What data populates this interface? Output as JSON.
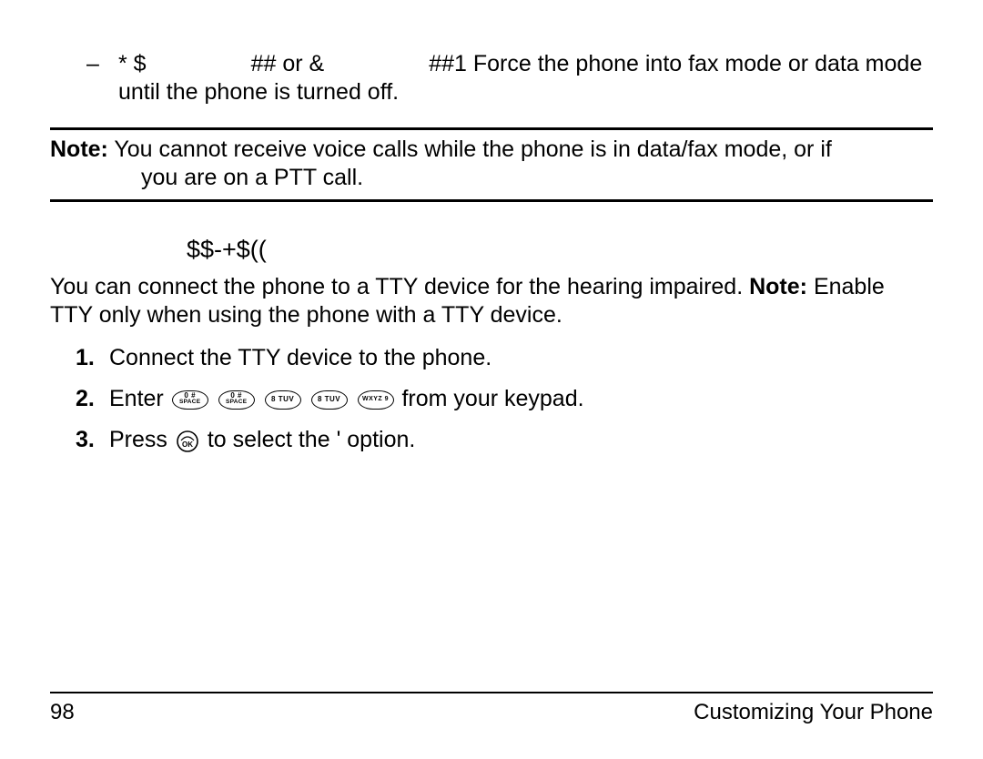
{
  "bullet": {
    "dash": "–",
    "prefix": "* $",
    "mid": "## or &",
    "rest": "##1  Force the phone into fax mode or data mode until the phone is turned off."
  },
  "note1": {
    "label": "Note:",
    "line1": " You cannot receive voice calls while the phone is in data/fax mode, or if",
    "line2": "you are on a PTT call."
  },
  "heading": "$$-+$((",
  "tty_intro": {
    "pre": "You can connect the phone to a TTY device for the hearing impaired. ",
    "note_label": "Note:",
    "post": " Enable TTY only when using the phone with a TTY device."
  },
  "steps": {
    "s1": {
      "num": "1.",
      "text": "Connect the TTY device to the phone."
    },
    "s2": {
      "num": "2.",
      "pre": "Enter ",
      "post": " from your keypad."
    },
    "s3": {
      "num": "3.",
      "pre": "Press ",
      "mid": " to select the ",
      "opt": "  '  ",
      "post": " option."
    }
  },
  "keys": {
    "space": {
      "top": "0 #",
      "bot": "SPACE"
    },
    "eight": {
      "top": "8 TUV",
      "bot": ""
    },
    "nine": {
      "top": "WXYZ 9",
      "bot": ""
    }
  },
  "footer": {
    "page": "98",
    "title": "Customizing Your Phone"
  }
}
